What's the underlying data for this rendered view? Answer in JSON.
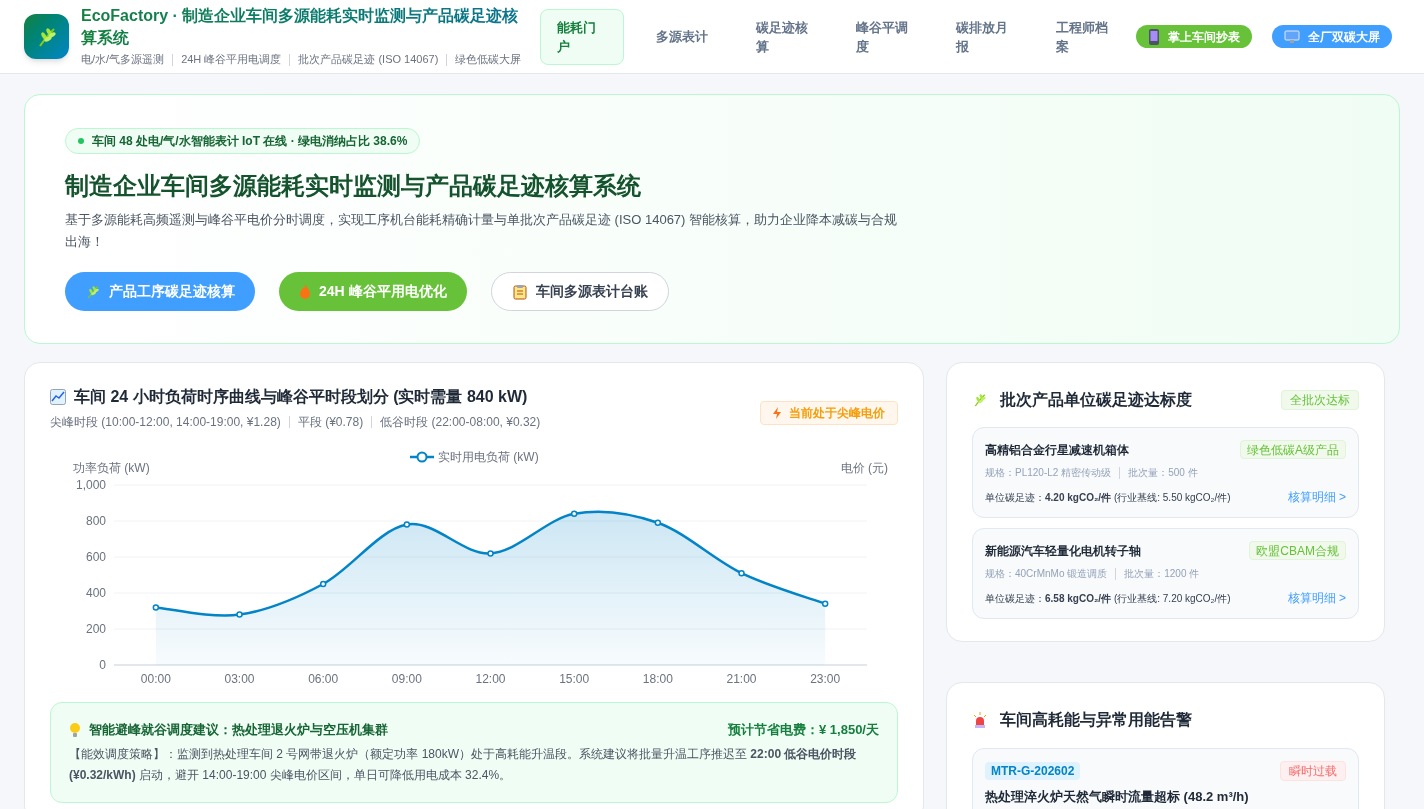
{
  "header": {
    "title": "EcoFactory · 制造企业车间多源能耗实时监测与产品碳足迹核算系统",
    "subtitles": [
      "电/水/气多源遥测",
      "24H 峰谷平用电调度",
      "批次产品碳足迹 (ISO 14067)",
      "绿色低碳大屏"
    ],
    "nav": [
      {
        "label": "能耗门户",
        "selected": true
      },
      {
        "label": "多源表计",
        "selected": false
      },
      {
        "label": "碳足迹核算",
        "selected": false
      },
      {
        "label": "峰谷平调度",
        "selected": false
      },
      {
        "label": "碳排放月报",
        "selected": false
      },
      {
        "label": "工程师档案",
        "selected": false
      }
    ],
    "actions": [
      {
        "label": "掌上车间抄表",
        "kind": "mobile"
      },
      {
        "label": "全厂双碳大屏",
        "kind": "screen"
      }
    ]
  },
  "hero": {
    "status": "车间 48 处电/气/水智能表计 IoT 在线 · 绿电消纳占比 38.6%",
    "title": "制造企业车间多源能耗实时监测与产品碳足迹核算系统",
    "description": "基于多源能耗高频遥测与峰谷平电价分时调度，实现工序机台能耗精确计量与单批次产品碳足迹 (ISO 14067) 智能核算，助力企业降本减碳与合规出海！",
    "buttons": [
      {
        "label": "产品工序碳足迹核算",
        "kind": "primary"
      },
      {
        "label": "24H 峰谷平用电优化",
        "kind": "success"
      },
      {
        "label": "车间多源表计台账",
        "kind": "outline"
      }
    ]
  },
  "load_panel": {
    "title": "车间 24 小时负荷时序曲线与峰谷平时段划分 (实时需量 840 kW)",
    "periods": [
      "尖峰时段 (10:00-12:00, 14:00-19:00, ¥1.28)",
      "平段 (¥0.78)",
      "低谷时段 (22:00-08:00, ¥0.32)"
    ],
    "badge": "当前处于尖峰电价",
    "right_axis_label": "电价 (元)",
    "chart_data": {
      "type": "area",
      "grid": true,
      "ylabel": "功率负荷 (kW)",
      "categories": [
        "00:00",
        "03:00",
        "06:00",
        "09:00",
        "12:00",
        "15:00",
        "18:00",
        "21:00",
        "23:00"
      ],
      "ylim": [
        0,
        1000
      ],
      "yticks": [
        0,
        200,
        400,
        600,
        800,
        {
          "value": 1000,
          "label": "1,000"
        }
      ],
      "series": [
        {
          "name": "实时用电负荷 (kW)",
          "color": "#0284c7",
          "marker": "circle",
          "values": [
            320,
            280,
            450,
            780,
            620,
            840,
            790,
            510,
            340
          ]
        }
      ]
    },
    "advice": {
      "title": "智能避峰就谷调度建议：热处理退火炉与空压机集群",
      "saving": "预计节省电费：¥ 1,850/天",
      "body": "【能效调度策略】：监测到热处理车间 2 号网带退火炉（额定功率 180kW）处于高耗能升温段。系统建议将批量升温工序推迟至 **22:00 低谷电价时段 (¥0.32/kWh)** 启动，避开 14:00-19:00 尖峰电价区间，单日可降低用电成本 32.4%。"
    }
  },
  "footprint_panel": {
    "title": "批次产品单位碳足迹达标度",
    "badge": "全批次达标",
    "products": [
      {
        "name": "高精铝合金行星减速机箱体",
        "tag": "绿色低碳A级产品",
        "spec": "规格：PL120-L2 精密传动级",
        "batch": "批次量：500 件",
        "footprint": "单位碳足迹：**4.20 kgCO₂/件** (行业基线: 5.50 kgCO₂/件)",
        "link": "核算明细 >"
      },
      {
        "name": "新能源汽车轻量化电机转子轴",
        "tag": "欧盟CBAM合规",
        "spec": "规格：40CrMnMo 锻造调质",
        "batch": "批次量：1200 件",
        "footprint": "单位碳足迹：**6.58 kgCO₂/件** (行业基线: 7.20 kgCO₂/件)",
        "link": "核算明细 >"
      }
    ]
  },
  "alert_panel": {
    "title": "车间高耗能与异常用能告警",
    "alerts": [
      {
        "meter": "MTR-G-202602",
        "tag": "瞬时过载",
        "title": "热处理淬火炉天然气瞬时流量超标 (48.2 m³/h)"
      }
    ]
  }
}
